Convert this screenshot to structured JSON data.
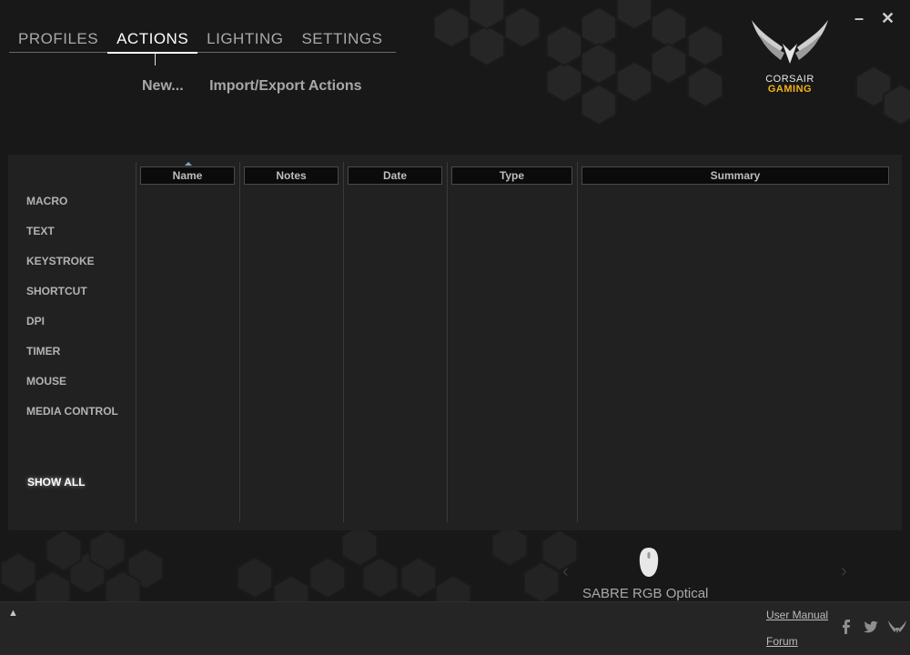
{
  "window": {
    "minimize_label": "–",
    "close_label": "✕"
  },
  "nav": {
    "tabs": [
      {
        "label": "PROFILES"
      },
      {
        "label": "ACTIONS"
      },
      {
        "label": "LIGHTING"
      },
      {
        "label": "SETTINGS"
      }
    ],
    "active_tab": "ACTIONS"
  },
  "subnav": {
    "new_label": "New...",
    "import_export_label": "Import/Export Actions"
  },
  "logo": {
    "line1": "CORSAIR",
    "line2": "GAMING",
    "icon": "corsair-sails-icon",
    "accent_color": "#f2b21a"
  },
  "categories": [
    "MACRO",
    "TEXT",
    "KEYSTROKE",
    "SHORTCUT",
    "DPI",
    "TIMER",
    "MOUSE",
    "MEDIA CONTROL"
  ],
  "show_all_label": "SHOW ALL",
  "table": {
    "columns": [
      "Name",
      "Notes",
      "Date",
      "Type",
      "Summary"
    ],
    "rows": []
  },
  "device": {
    "name": "SABRE RGB Optical",
    "icon": "mouse-icon"
  },
  "footer": {
    "user_manual_label": "User Manual",
    "forum_label": "Forum",
    "social_icons": [
      "facebook-icon",
      "twitter-icon",
      "corsair-icon"
    ]
  }
}
